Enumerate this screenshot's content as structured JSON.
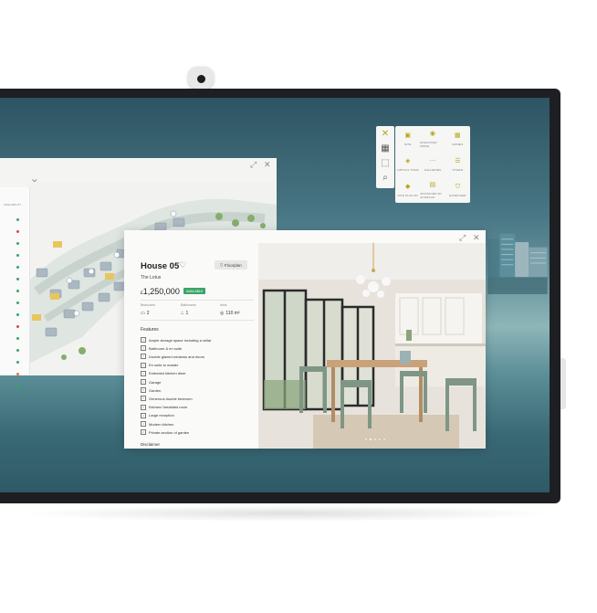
{
  "colors": {
    "accent": "#b7a31c",
    "available": "#3aa468",
    "reserved": "#e07b39",
    "sold": "#d24d4d"
  },
  "toolbar": {
    "icons": [
      "close-icon",
      "grid-icon",
      "cursor-select-icon",
      "search-icon"
    ]
  },
  "launcher": {
    "apps": [
      {
        "label": "SITE",
        "icon": "site-icon"
      },
      {
        "label": "ENHANCED MODE",
        "icon": "enhanced-mode-icon"
      },
      {
        "label": "HOMES",
        "icon": "homes-icon"
      },
      {
        "label": "VIRTUAL TOUR",
        "icon": "virtual-tour-icon"
      },
      {
        "label": "GALLERIES",
        "icon": "galleries-icon"
      },
      {
        "label": "OTHER",
        "icon": "other-icon"
      },
      {
        "label": "SITE PLAN 3D",
        "icon": "site-plan-3d-icon"
      },
      {
        "label": "ADVANCED 2D SITEPLAN",
        "icon": "advanced-siteplan-icon"
      },
      {
        "label": "HANDOVER",
        "icon": "handover-icon"
      }
    ]
  },
  "map_window": {
    "availability_header": "AVAILABILITY",
    "status_dots": [
      "available",
      "sold",
      "available",
      "available",
      "available",
      "available",
      "available",
      "available",
      "available",
      "sold",
      "available",
      "available",
      "available",
      "reserved",
      "available"
    ]
  },
  "house": {
    "title": "House 05",
    "floorplan_label": "Floorplan",
    "type_name": "The Lotus",
    "price_prefix": "£",
    "price": "1,250,000",
    "status_badge": "AVAILABLE",
    "stats": {
      "bedrooms_label": "Bedrooms",
      "bedrooms": "2",
      "bathrooms_label": "Bathrooms",
      "bathrooms": "1",
      "area_label": "Area",
      "area": "110 m²"
    },
    "features_heading": "Features",
    "features": [
      "Ample storage space including a cellar",
      "Bathroom & en suite",
      "Double glazed windows and doors",
      "En suite to master",
      "Extended kitchen diner",
      "Garage",
      "Garden",
      "Generous double bedroom",
      "Kitchen/ breakfast room",
      "Large reception",
      "Modern kitchen",
      "Private section of garden"
    ],
    "disclaimer_heading": "Disclaimer"
  }
}
